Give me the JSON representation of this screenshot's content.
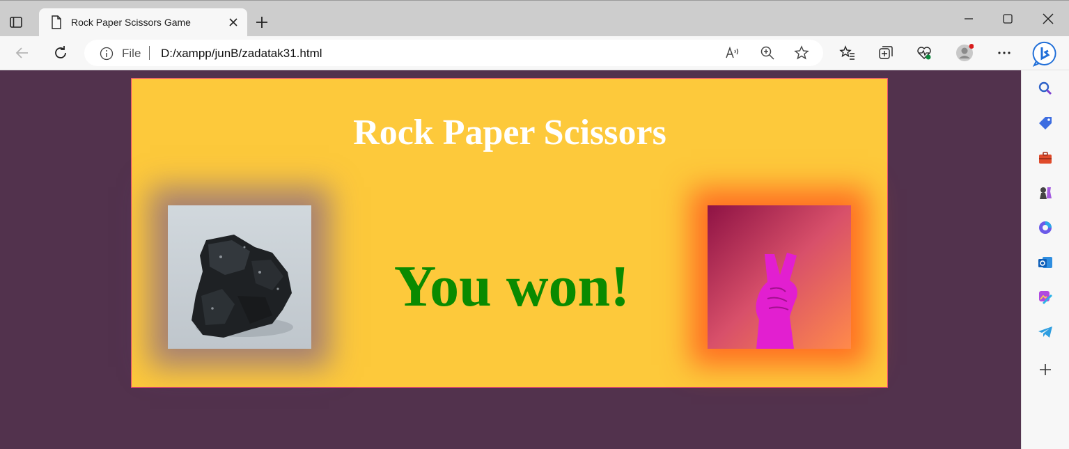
{
  "browser": {
    "tab": {
      "title": "Rock Paper Scissors Game"
    },
    "address_bar": {
      "scheme_label": "File",
      "url": "D:/xampp/junB/zadatak31.html"
    },
    "toolbar_icons": [
      "back-icon",
      "refresh-icon",
      "read-aloud-icon",
      "zoom-icon",
      "favorite-star-icon",
      "favorites-icon",
      "collections-icon",
      "browser-essentials-icon",
      "profile-icon",
      "more-icon",
      "bing-chat-icon"
    ],
    "sidebar_icons": [
      "search-icon",
      "shopping-tag-icon",
      "tools-icon",
      "games-icon",
      "microsoft-365-icon",
      "outlook-icon",
      "designer-icon",
      "telegram-icon",
      "add-icon"
    ],
    "window_controls": [
      "minimize-icon",
      "maximize-icon",
      "close-icon"
    ]
  },
  "game": {
    "title": "Rock Paper Scissors",
    "result": "You won!",
    "player_choice": "rock",
    "computer_choice": "scissors"
  },
  "colors": {
    "page_background": "#52324d",
    "card_background": "#fdc93b",
    "card_border": "#e84b6f",
    "title_color": "#ffffff",
    "result_color": "#0a8a00",
    "player_glow": "#5f46a0",
    "computer_glow": "#ff5f1e"
  }
}
